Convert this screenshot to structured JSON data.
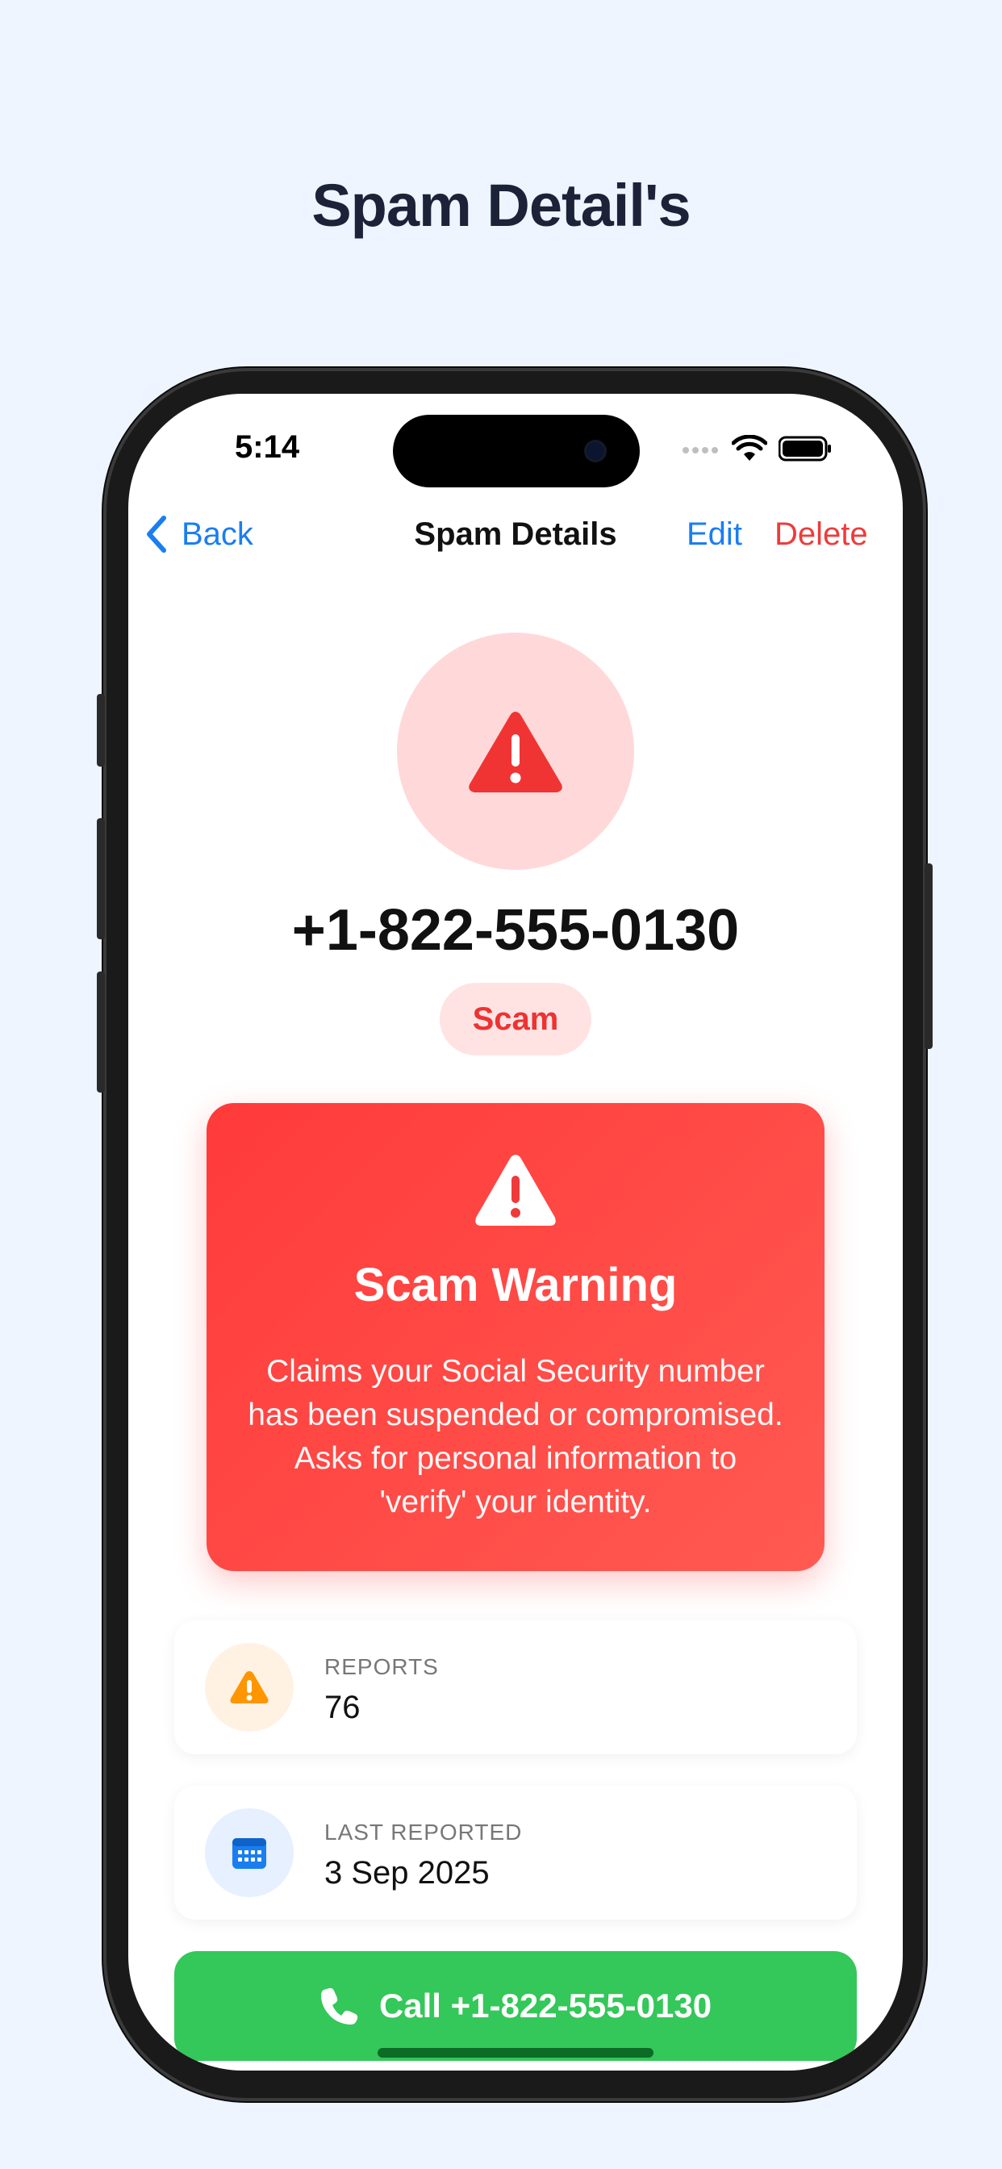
{
  "page": {
    "title": "Spam Detail's"
  },
  "status_bar": {
    "time": "5:14"
  },
  "nav": {
    "back_label": "Back",
    "title": "Spam Details",
    "edit_label": "Edit",
    "delete_label": "Delete"
  },
  "contact": {
    "phone_number": "+1-822-555-0130",
    "category": "Scam"
  },
  "warning": {
    "title": "Scam Warning",
    "description": "Claims your Social Security number has been suspended or compromised. Asks for personal information to 'verify' your identity."
  },
  "info": {
    "reports": {
      "label": "REPORTS",
      "value": "76",
      "icon": "warning-icon"
    },
    "last_reported": {
      "label": "LAST REPORTED",
      "value": "3 Sep 2025",
      "icon": "calendar-icon"
    }
  },
  "call_button": {
    "label": "Call +1-822-555-0130"
  },
  "colors": {
    "accent_blue": "#1a7ef0",
    "danger_red": "#ee3b3b",
    "call_green": "#34c759",
    "reports_orange": "#ff9500"
  }
}
